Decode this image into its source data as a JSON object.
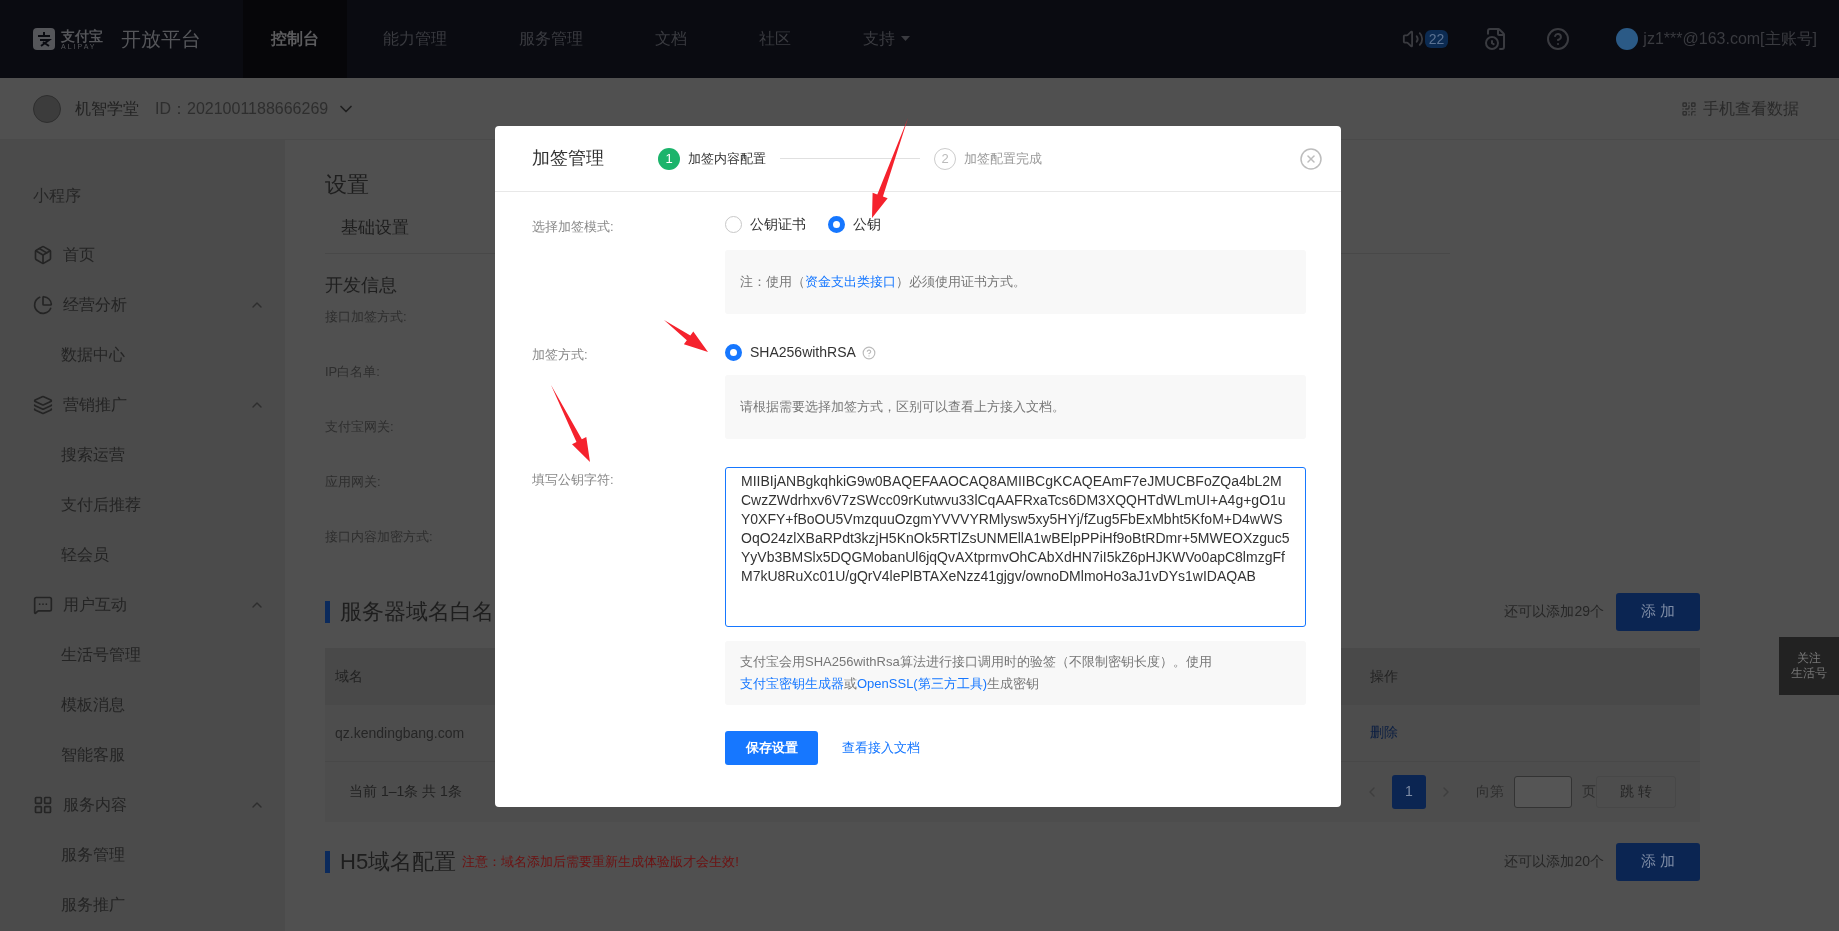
{
  "header": {
    "logo_text": "支付宝",
    "logo_sub": "ALIPAY",
    "title": "开放平台",
    "nav": [
      {
        "label": "控制台",
        "selected": true,
        "dropdown": false
      },
      {
        "label": "能力管理",
        "selected": false,
        "dropdown": false
      },
      {
        "label": "服务管理",
        "selected": false,
        "dropdown": false
      },
      {
        "label": "文档",
        "selected": false,
        "dropdown": false
      },
      {
        "label": "社区",
        "selected": false,
        "dropdown": false
      },
      {
        "label": "支持",
        "selected": false,
        "dropdown": true
      }
    ],
    "notification_count": "22",
    "account": "jz1***@163.com[主账号]"
  },
  "subheader": {
    "app_name": "机智学堂",
    "app_id": "ID：2021001188666269",
    "mobile_link": "手机查看数据"
  },
  "sidebar": {
    "section": "小程序",
    "items": [
      {
        "label": "首页",
        "kind": "home"
      },
      {
        "label": "经营分析",
        "kind": "chart",
        "expanded": true,
        "children": [
          {
            "label": "数据中心"
          }
        ]
      },
      {
        "label": "营销推广",
        "kind": "layers",
        "expanded": true,
        "children": [
          {
            "label": "搜索运营"
          },
          {
            "label": "支付后推荐"
          },
          {
            "label": "轻会员"
          }
        ]
      },
      {
        "label": "用户互动",
        "kind": "chat",
        "expanded": true,
        "children": [
          {
            "label": "生活号管理"
          },
          {
            "label": "模板消息"
          },
          {
            "label": "智能客服"
          }
        ]
      },
      {
        "label": "服务内容",
        "kind": "grid",
        "expanded": true,
        "children": [
          {
            "label": "服务管理"
          },
          {
            "label": "服务推广"
          }
        ]
      }
    ]
  },
  "main": {
    "title": "设置",
    "tabs": [
      {
        "label": "基础设置",
        "selected": true
      }
    ],
    "dev_info": {
      "heading": "开发信息",
      "fields": [
        "接口加签方式:",
        "IP白名单:",
        "支付宝网关:",
        "应用网关:",
        "接口内容加密方式:"
      ]
    },
    "server_domains": {
      "heading": "服务器域名白名",
      "remaining": "还可以添加29个",
      "add_button": "添 加",
      "columns": [
        "域名",
        "操作"
      ],
      "rows": [
        {
          "domain": "qz.kendingbang.com",
          "action": "删除"
        }
      ],
      "pagination": {
        "summary": "当前 1–1条 共 1条",
        "pages": [
          {
            "label": "1",
            "selected": true
          }
        ],
        "goto_prefix": "向第",
        "goto_suffix": "页",
        "goto_button": "跳 转"
      }
    },
    "h5_domains": {
      "heading": "H5域名配置",
      "warning": "注意：域名添加后需要重新生成体验版才会生效!",
      "remaining": "还可以添加20个",
      "add_button": "添 加"
    }
  },
  "follow_widget": [
    "关注",
    "生活号"
  ],
  "modal": {
    "title": "加签管理",
    "steps": [
      {
        "number": "1",
        "label": "加签内容配置",
        "current": true
      },
      {
        "number": "2",
        "label": "加签配置完成",
        "current": false
      }
    ],
    "sign_mode": {
      "label": "选择加签模式:",
      "options": [
        {
          "label": "公钥证书",
          "selected": false
        },
        {
          "label": "公钥",
          "selected": true
        }
      ],
      "note": {
        "before": "注：使用（",
        "link": "资金支出类接口",
        "after": "）必须使用证书方式。"
      }
    },
    "sign_method": {
      "label": "加签方式:",
      "options": [
        {
          "label": "SHA256withRSA",
          "selected": true
        }
      ],
      "hint": "请根据需要选择加签方式，区别可以查看上方接入文档。"
    },
    "public_key": {
      "label": "填写公钥字符:",
      "value": "MIIBIjANBgkqhkiG9w0BAQEFAAOCAQ8AMIIBCgKCAQEAmF7eJMUCBFoZQa4bL2MCwzZWdrhxv6V7zSWcc09rKutwvu33lCqAAFRxaTcs6DM3XQQHTdWLmUI+A4g+gO1uY0XFY+fBoOU5VmzquuOzgmYVVVYRMlysw5xy5HYj/fZug5FbExMbht5KfoM+D4wWSOqO24zlXBaRPdt3kzjH5KnOk5RTlZsUNMEllA1wBElpPPiHf9oBtRDmr+5MWEOXzguc5YyVb3BMSlx5DQGMobanUl6jqQvAXtprmvOhCAbXdHN7iI5kZ6pHJKWVo0apC8lmzgFfM7kU8RuXc01U/gQrV4lePlBTAXeNzz41gjgv/ownoDMlmoHo3aJ1vDYs1wIDAQAB"
    },
    "key_hint": {
      "before": "支付宝会用SHA256withRsa算法进行接口调用时的验签（不限制密钥长度）。使用",
      "link1": "支付宝密钥生成器",
      "middle": "或",
      "link2": "OpenSSL(第三方工具)",
      "after": "生成密钥"
    },
    "save_button": "保存设置",
    "doc_link": "查看接入文档"
  }
}
